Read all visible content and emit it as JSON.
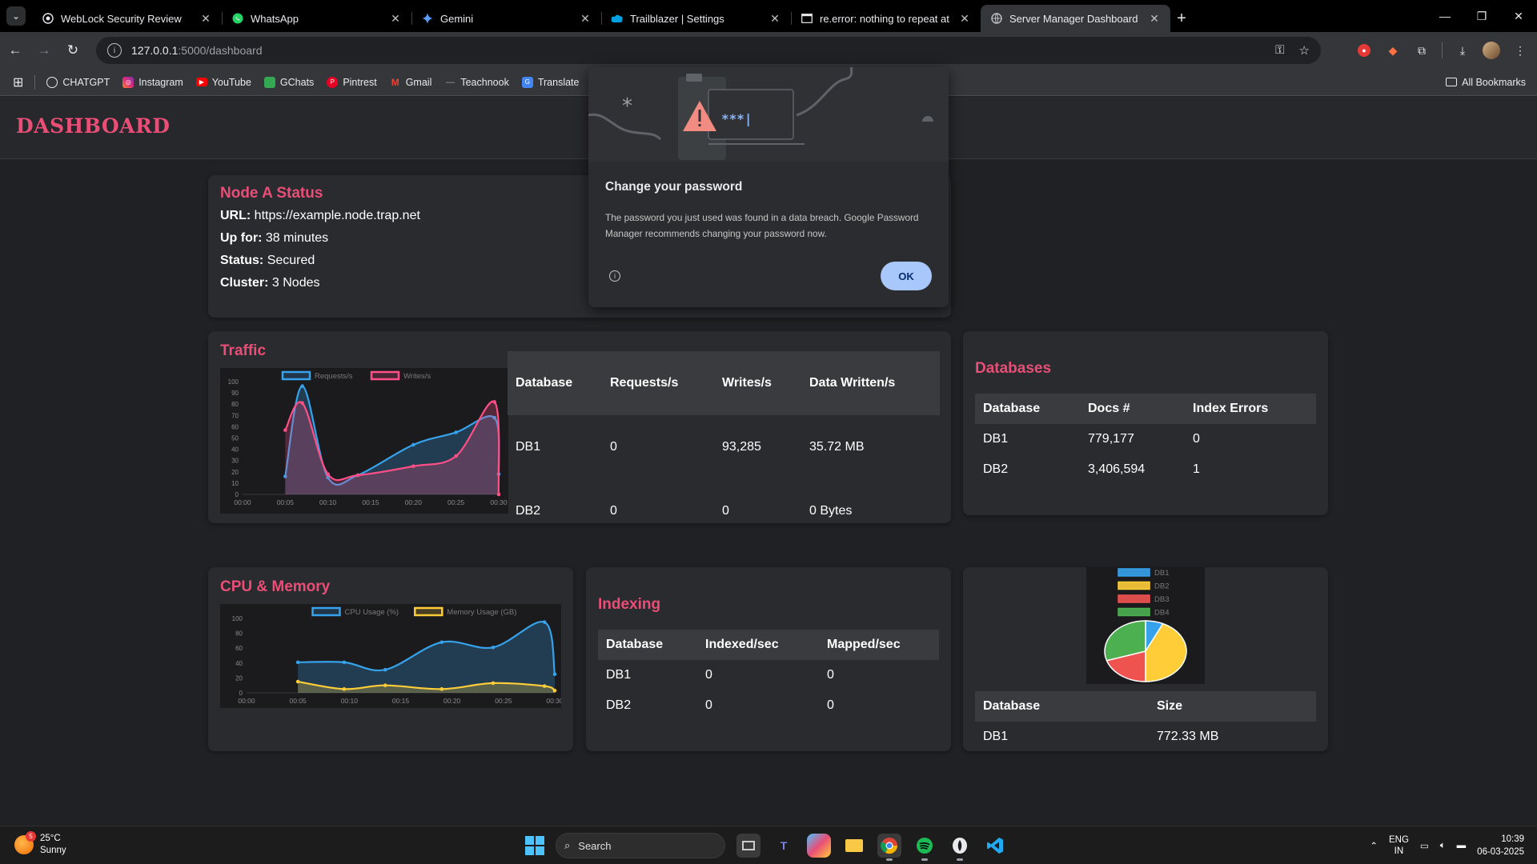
{
  "browser": {
    "tabs": [
      {
        "title": "WebLock Security Review",
        "icon": "globe-icon",
        "active": false
      },
      {
        "title": "WhatsApp",
        "icon": "whatsapp-icon",
        "active": false
      },
      {
        "title": "Gemini",
        "icon": "gemini-icon",
        "active": false
      },
      {
        "title": "Trailblazer | Settings",
        "icon": "salesforce-cloud-icon",
        "active": false
      },
      {
        "title": "re.error: nothing to repeat at po",
        "icon": "terminal-icon",
        "active": false
      },
      {
        "title": "Server Manager Dashboard",
        "icon": "globe-icon",
        "active": true
      }
    ],
    "url_host": "127.0.0.1",
    "url_path": ":5000/dashboard",
    "bookmarks": [
      {
        "label": "CHATGPT",
        "color": "#e8eaed"
      },
      {
        "label": "Instagram",
        "color": "#d6249f"
      },
      {
        "label": "YouTube",
        "color": "#ff0000"
      },
      {
        "label": "GChats",
        "color": "#34a853"
      },
      {
        "label": "Pintrest",
        "color": "#e60023"
      },
      {
        "label": "Gmail",
        "color": "#ea4335"
      },
      {
        "label": "Teachnook",
        "color": "#9aa0a6"
      },
      {
        "label": "Translate",
        "color": "#4285f4"
      }
    ],
    "all_bookmarks": "All Bookmarks"
  },
  "dashboard": {
    "title": "DASHBOARD",
    "node": {
      "title": "Node A Status",
      "url_label": "URL:",
      "url_value": "https://example.node.trap.net",
      "up_label": "Up for:",
      "up_value": "38 minutes",
      "status_label": "Status:",
      "status_value": "Secured",
      "cluster_label": "Cluster:",
      "cluster_value": "3 Nodes"
    },
    "traffic": {
      "title": "Traffic",
      "columns": [
        "Database",
        "Requests/s",
        "Writes/s",
        "Data Written/s"
      ],
      "rows": [
        [
          "DB1",
          "0",
          "93,285",
          "35.72 MB"
        ],
        [
          "DB2",
          "0",
          "0",
          "0 Bytes"
        ]
      ]
    },
    "databases": {
      "title": "Databases",
      "columns": [
        "Database",
        "Docs #",
        "Index Errors"
      ],
      "rows": [
        [
          "DB1",
          "779,177",
          "0"
        ],
        [
          "DB2",
          "3,406,594",
          "1"
        ]
      ]
    },
    "cpu": {
      "title": "CPU & Memory"
    },
    "indexing": {
      "title": "Indexing",
      "columns": [
        "Database",
        "Indexed/sec",
        "Mapped/sec"
      ],
      "rows": [
        [
          "DB1",
          "0",
          "0"
        ],
        [
          "DB2",
          "0",
          "0"
        ]
      ]
    },
    "storage": {
      "columns": [
        "Database",
        "Size"
      ],
      "rows": [
        [
          "DB1",
          "772.33 MB"
        ]
      ]
    }
  },
  "chart_data": [
    {
      "type": "line",
      "x": [
        "00:00",
        "00:05",
        "00:10",
        "00:15",
        "00:20",
        "00:25",
        "00:30"
      ],
      "ylim": [
        0,
        100
      ],
      "yticks": [
        0,
        10,
        20,
        30,
        40,
        50,
        60,
        70,
        80,
        90,
        100
      ],
      "series": [
        {
          "name": "Requests/s",
          "color": "#36a2eb",
          "x": [
            5,
            7,
            10,
            13.5,
            20,
            25,
            29.5,
            30
          ],
          "values": [
            16,
            96,
            15,
            17,
            44,
            55,
            68,
            18
          ]
        },
        {
          "name": "Writes/s",
          "color": "#ff4f86",
          "x": [
            5,
            7,
            10,
            13.5,
            20,
            25,
            29.5,
            30
          ],
          "values": [
            57,
            81,
            18,
            17,
            25,
            34,
            82,
            0
          ]
        }
      ]
    },
    {
      "type": "line",
      "x": [
        "00:00",
        "00:05",
        "00:10",
        "00:15",
        "00:20",
        "00:25",
        "00:30"
      ],
      "ylim": [
        0,
        100
      ],
      "yticks": [
        0,
        20,
        40,
        60,
        80,
        100
      ],
      "series": [
        {
          "name": "CPU Usage (%)",
          "color": "#36a2eb",
          "x": [
            5,
            9.5,
            13.5,
            19,
            24,
            29,
            30
          ],
          "values": [
            41,
            41,
            31,
            68,
            61,
            95,
            25
          ]
        },
        {
          "name": "Memory Usage (GB)",
          "color": "#ffcd38",
          "x": [
            5,
            9.5,
            13.5,
            19,
            24,
            29,
            30
          ],
          "values": [
            15,
            5,
            10,
            5,
            13,
            9,
            3
          ]
        }
      ]
    },
    {
      "type": "pie",
      "labels": [
        "DB1",
        "DB2",
        "DB3",
        "DB4"
      ],
      "colors": [
        "#36a2eb",
        "#ffcd38",
        "#ef5350",
        "#4caf50"
      ],
      "values": [
        7,
        43,
        20,
        30
      ]
    }
  ],
  "popup": {
    "title": "Change your password",
    "body": "The password you just used was found in a data breach. Google Password Manager recommends changing your password now.",
    "ok": "OK",
    "art_text": "***|"
  },
  "taskbar": {
    "temp": "25°C",
    "condition": "Sunny",
    "badge": "5",
    "search": "Search",
    "lang1": "ENG",
    "lang2": "IN",
    "time": "10:39",
    "date": "06-03-2025"
  }
}
